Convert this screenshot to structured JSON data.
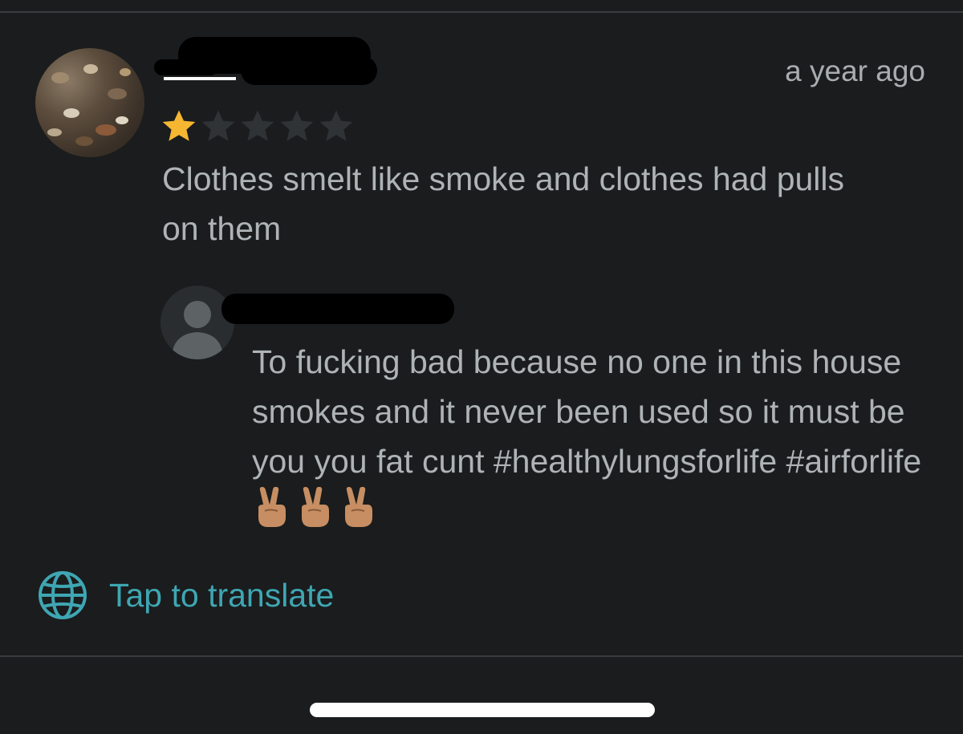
{
  "review": {
    "timestamp": "a year ago",
    "rating": 1,
    "rating_max": 5,
    "text": "Clothes smelt like smoke and clothes had pulls on them"
  },
  "reply": {
    "text": "To fucking bad because no one in this house smokes and it never been used so it must be you you fat cunt #healthylungsforlife #airforlife",
    "emoji": [
      "peace-sign-emoji",
      "peace-sign-emoji",
      "peace-sign-emoji"
    ]
  },
  "translate": {
    "label": "Tap to translate",
    "icon": "globe-icon"
  },
  "colors": {
    "background": "#1a1c1d",
    "text": "#aeb3b6",
    "accent": "#3fa6b3",
    "star_filled": "#f5b731",
    "star_empty": "#2f3336"
  }
}
